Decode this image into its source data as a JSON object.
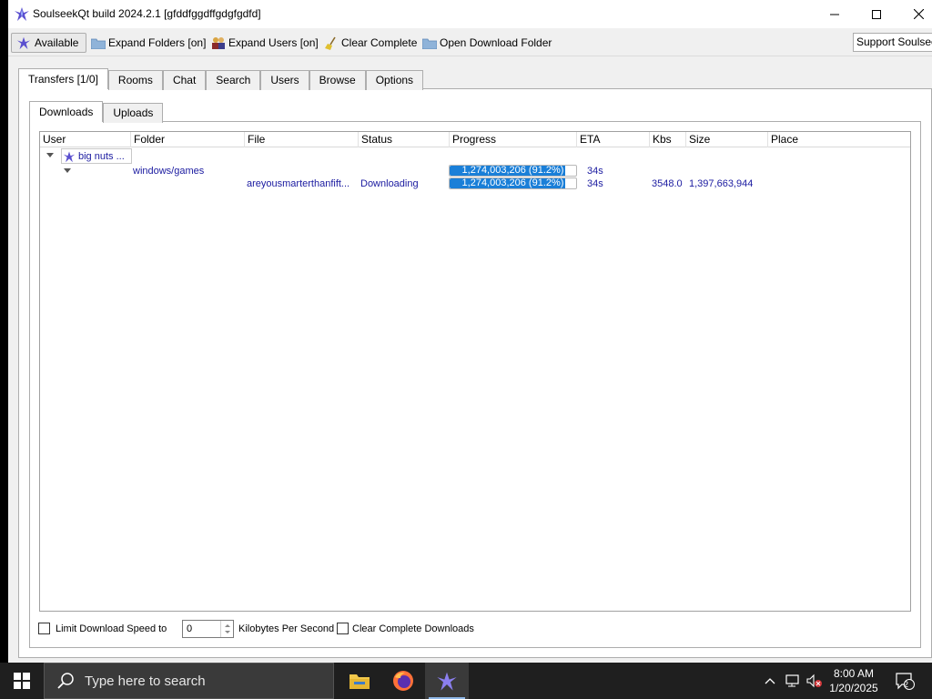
{
  "window": {
    "title": "SoulseekQt build 2024.2.1 [gfddfggdffgdgfgdfd]"
  },
  "toolbar": {
    "available_label": "Available",
    "expand_folders_label": "Expand Folders [on]",
    "expand_users_label": "Expand Users [on]",
    "clear_complete_label": "Clear Complete",
    "open_download_folder_label": "Open Download Folder",
    "support_label": "Support Soulseek"
  },
  "main_tabs": [
    "Transfers [1/0]",
    "Rooms",
    "Chat",
    "Search",
    "Users",
    "Browse",
    "Options"
  ],
  "sub_tabs": [
    "Downloads",
    "Uploads"
  ],
  "table": {
    "columns": [
      "User",
      "Folder",
      "File",
      "Status",
      "Progress",
      "ETA",
      "Kbs",
      "Size",
      "Place"
    ],
    "user_row": {
      "user": "big nuts ..."
    },
    "folder_row": {
      "folder": "windows/games",
      "progress_text": "1,274,003,206 (91.2%)",
      "progress_fraction": 0.912,
      "eta": "34s"
    },
    "file_row": {
      "file": "areyousmarterthanfift...",
      "status": "Downloading",
      "progress_text": "1,274,003,206 (91.2%)",
      "progress_fraction": 0.912,
      "eta": "34s",
      "kbs": "3548.0",
      "size": "1,397,663,944"
    }
  },
  "bottom": {
    "limit_label": "Limit Download Speed to",
    "limit_value": "0",
    "units_label": "Kilobytes Per Second",
    "clear_complete_downloads_label": "Clear Complete Downloads"
  },
  "taskbar": {
    "search_placeholder": "Type here to search",
    "time": "8:00 AM",
    "date": "1/20/2025",
    "notification_count": "2"
  },
  "colors": {
    "link_text": "#1a1aa0",
    "progress_fill": "#1a7fd8",
    "taskbar_bg": "#1f1f1f"
  },
  "icons": [
    "soulseek-bird-icon",
    "folder-icon",
    "users-icon",
    "broom-icon",
    "windows-logo-icon",
    "magnifier-icon",
    "file-explorer-icon",
    "firefox-icon",
    "chevron-up-icon",
    "network-icon",
    "speaker-muted-icon",
    "notification-icon"
  ]
}
